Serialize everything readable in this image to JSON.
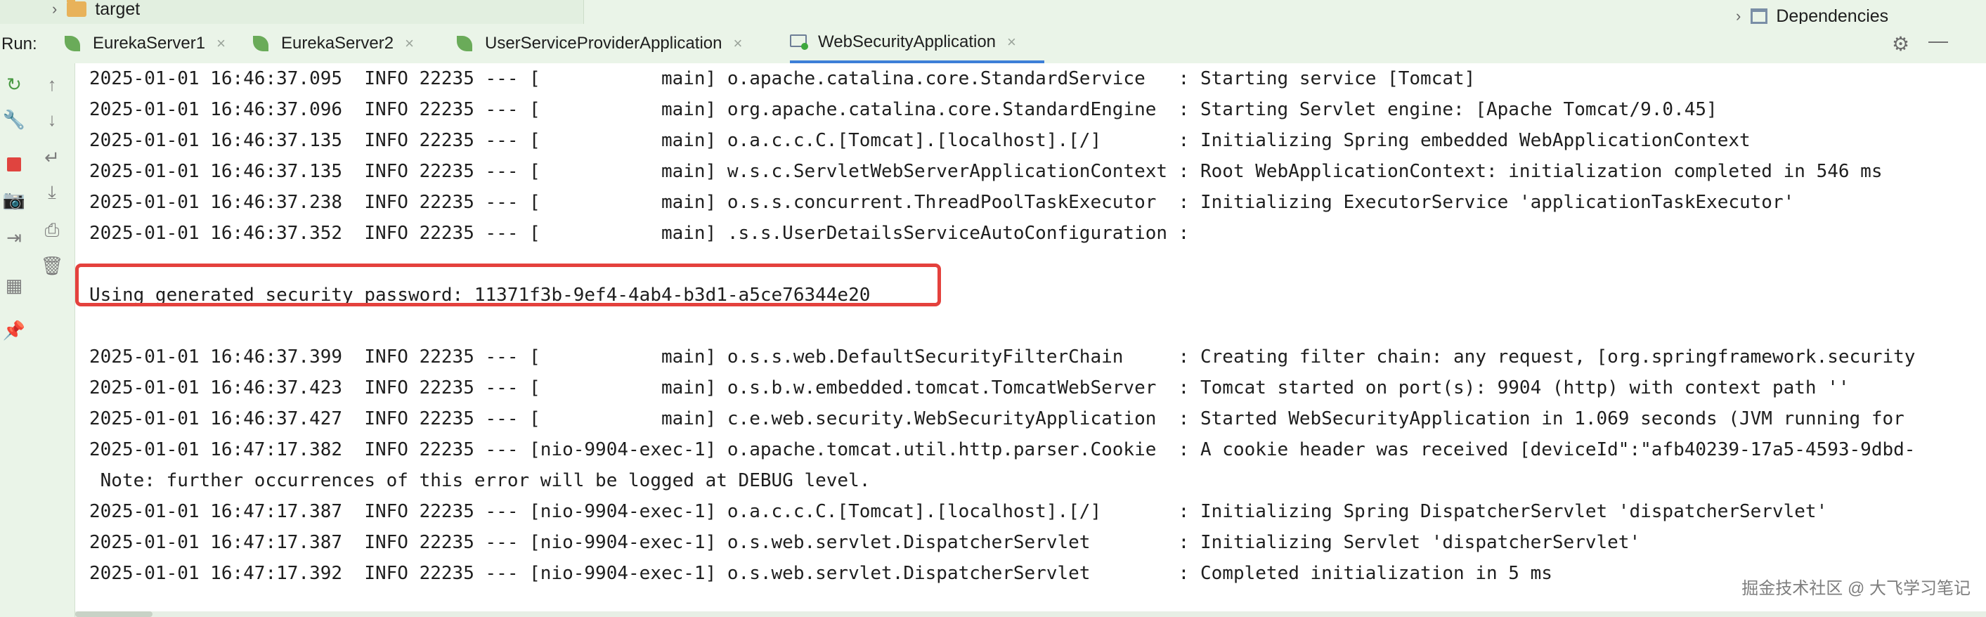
{
  "project_tree": {
    "left_item": "target",
    "right_item": "Dependencies"
  },
  "run_bar": {
    "label": "Run:",
    "tabs": [
      {
        "label": "EurekaServer1",
        "close": "×"
      },
      {
        "label": "EurekaServer2",
        "close": "×"
      },
      {
        "label": "UserServiceProviderApplication",
        "close": "×"
      },
      {
        "label": "WebSecurityApplication",
        "close": "×"
      }
    ],
    "settings_icon": "gear-icon",
    "minimize_icon": "minimize-icon"
  },
  "toolbar_icons": {
    "left": [
      "rerun-icon",
      "wrench-icon",
      "stop-icon",
      "camera-icon",
      "login-icon",
      "layout-icon",
      "pin-icon"
    ],
    "right": [
      "up-arrow-icon",
      "down-arrow-icon",
      "soft-wrap-icon",
      "scroll-to-end-icon",
      "print-icon",
      "trash-icon"
    ]
  },
  "console": {
    "lines": [
      "2025-01-01 16:46:37.095  INFO 22235 --- [           main] o.apache.catalina.core.StandardService   : Starting service [Tomcat]",
      "2025-01-01 16:46:37.096  INFO 22235 --- [           main] org.apache.catalina.core.StandardEngine  : Starting Servlet engine: [Apache Tomcat/9.0.45]",
      "2025-01-01 16:46:37.135  INFO 22235 --- [           main] o.a.c.c.C.[Tomcat].[localhost].[/]       : Initializing Spring embedded WebApplicationContext",
      "2025-01-01 16:46:37.135  INFO 22235 --- [           main] w.s.c.ServletWebServerApplicationContext : Root WebApplicationContext: initialization completed in 546 ms",
      "2025-01-01 16:46:37.238  INFO 22235 --- [           main] o.s.s.concurrent.ThreadPoolTaskExecutor  : Initializing ExecutorService 'applicationTaskExecutor'",
      "2025-01-01 16:46:37.352  INFO 22235 --- [           main] .s.s.UserDetailsServiceAutoConfiguration :",
      "",
      "Using generated security password: 11371f3b-9ef4-4ab4-b3d1-a5ce76344e20",
      "",
      "2025-01-01 16:46:37.399  INFO 22235 --- [           main] o.s.s.web.DefaultSecurityFilterChain     : Creating filter chain: any request, [org.springframework.security",
      "2025-01-01 16:46:37.423  INFO 22235 --- [           main] o.s.b.w.embedded.tomcat.TomcatWebServer  : Tomcat started on port(s): 9904 (http) with context path ''",
      "2025-01-01 16:46:37.427  INFO 22235 --- [           main] c.e.web.security.WebSecurityApplication  : Started WebSecurityApplication in 1.069 seconds (JVM running for",
      "2025-01-01 16:47:17.382  INFO 22235 --- [nio-9904-exec-1] o.apache.tomcat.util.http.parser.Cookie  : A cookie header was received [deviceId\":\"afb40239-17a5-4593-9dbd-",
      " Note: further occurrences of this error will be logged at DEBUG level.",
      "2025-01-01 16:47:17.387  INFO 22235 --- [nio-9904-exec-1] o.a.c.c.C.[Tomcat].[localhost].[/]       : Initializing Spring DispatcherServlet 'dispatcherServlet'",
      "2025-01-01 16:47:17.387  INFO 22235 --- [nio-9904-exec-1] o.s.web.servlet.DispatcherServlet        : Initializing Servlet 'dispatcherServlet'",
      "2025-01-01 16:47:17.392  INFO 22235 --- [nio-9904-exec-1] o.s.web.servlet.DispatcherServlet        : Completed initialization in 5 ms"
    ]
  },
  "watermark": "掘金技术社区 @ 大飞学习笔记",
  "colors": {
    "panel_bg": "#eaf4e8",
    "console_bg": "#ffffff",
    "highlight": "#e4413d",
    "active_tab": "#3d7fd8"
  }
}
